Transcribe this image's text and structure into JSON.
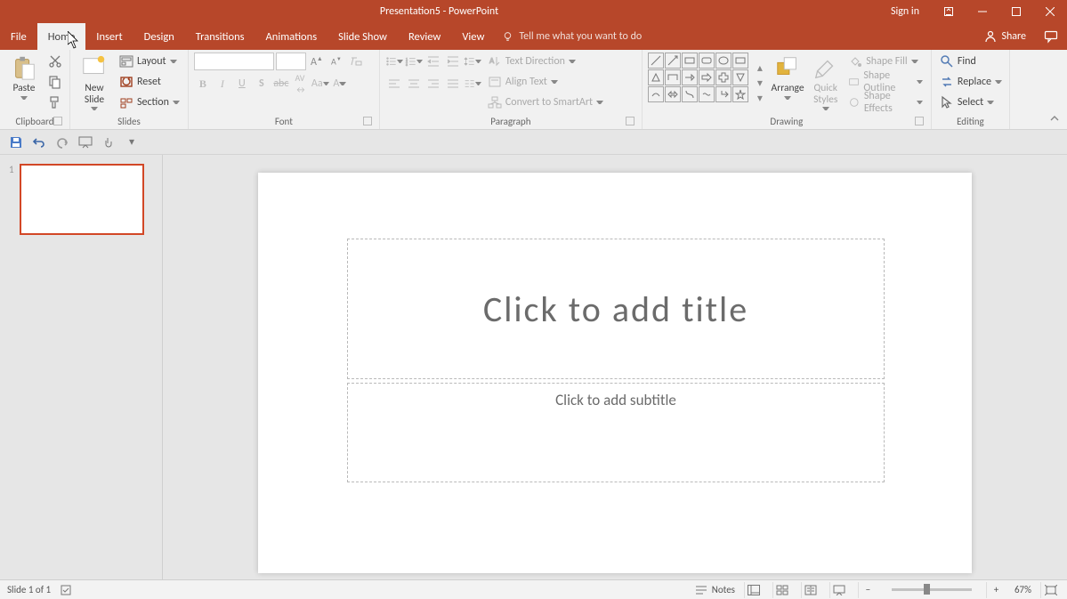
{
  "title": "Presentation5 - PowerPoint",
  "signin": "Sign in",
  "tabs": {
    "file": "File",
    "home": "Home",
    "insert": "Insert",
    "design": "Design",
    "transitions": "Transitions",
    "animations": "Animations",
    "slideshow": "Slide Show",
    "review": "Review",
    "view": "View"
  },
  "tell_me": "Tell me what you want to do",
  "share": "Share",
  "ribbon": {
    "clipboard": {
      "paste": "Paste",
      "label": "Clipboard"
    },
    "slides": {
      "new_slide": "New\nSlide",
      "layout": "Layout",
      "reset": "Reset",
      "section": "Section",
      "label": "Slides"
    },
    "font": {
      "label": "Font"
    },
    "paragraph": {
      "text_direction": "Text Direction",
      "align_text": "Align Text",
      "smartart": "Convert to SmartArt",
      "label": "Paragraph"
    },
    "drawing": {
      "arrange": "Arrange",
      "quick_styles": "Quick\nStyles",
      "shape_fill": "Shape Fill",
      "shape_outline": "Shape Outline",
      "shape_effects": "Shape Effects",
      "label": "Drawing"
    },
    "editing": {
      "find": "Find",
      "replace": "Replace",
      "select": "Select",
      "label": "Editing"
    }
  },
  "thumbs": {
    "1": "1"
  },
  "placeholders": {
    "title": "Click to add title",
    "subtitle": "Click to add subtitle"
  },
  "status": {
    "slide": "Slide 1 of 1",
    "notes": "Notes",
    "zoom": "67%"
  }
}
